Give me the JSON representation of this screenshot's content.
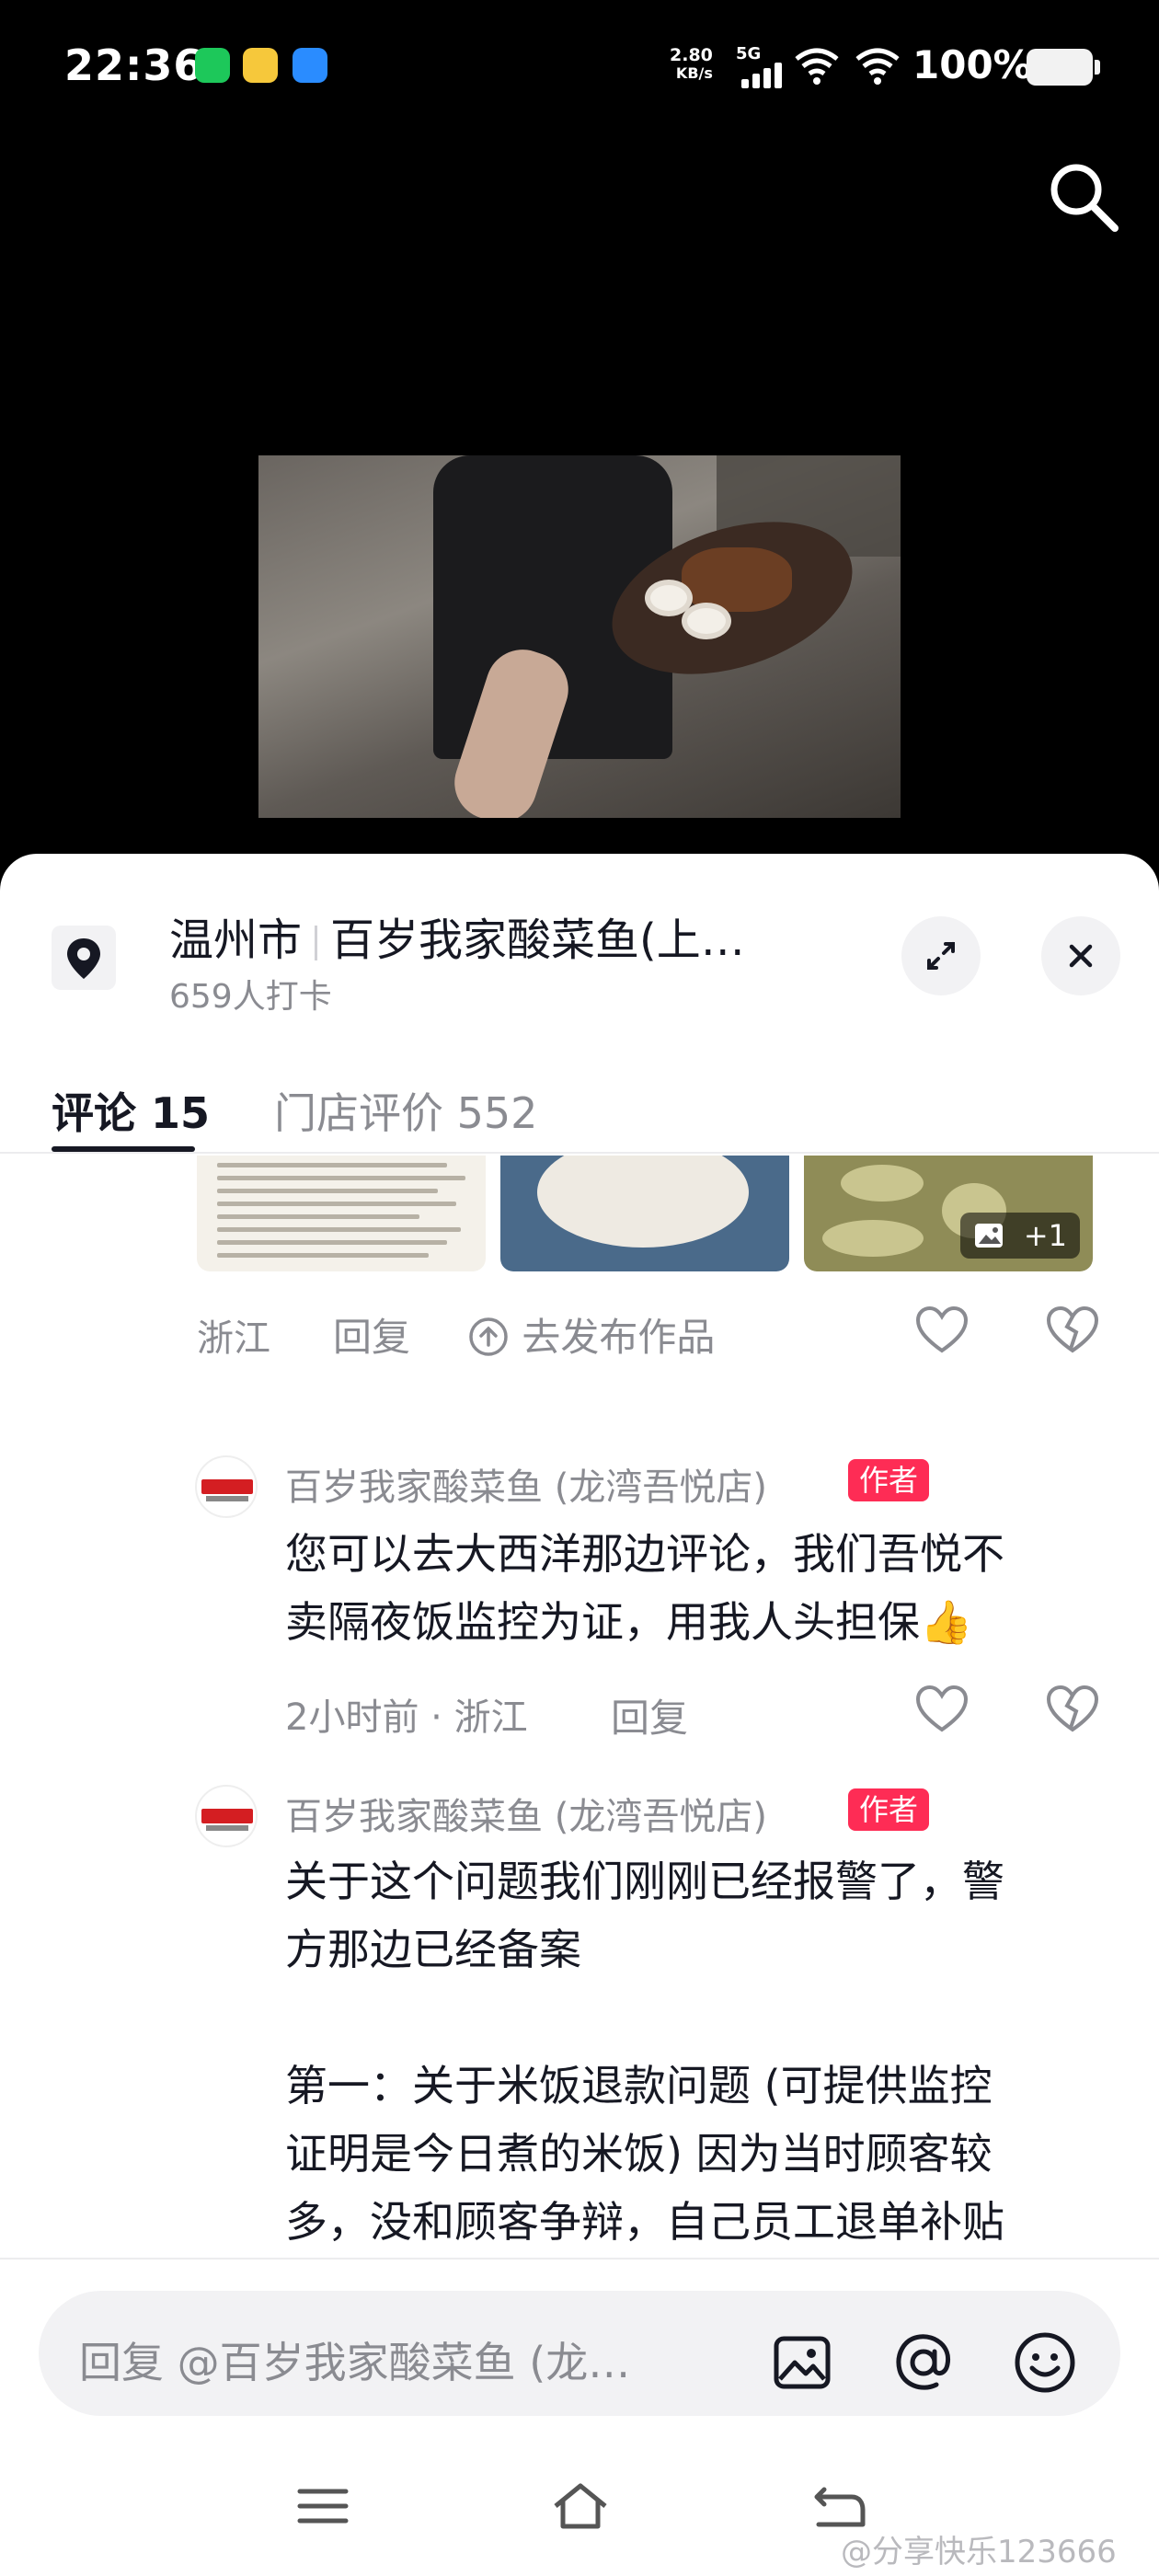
{
  "status_bar": {
    "time": "22:36",
    "net_speed": "2.80",
    "net_unit": "KB/s",
    "signal": "5G",
    "battery": "100%"
  },
  "location": {
    "city": "温州市",
    "store": "百岁我家酸菜鱼(上…",
    "checkins": "659人打卡"
  },
  "tabs": [
    {
      "label": "评论 15"
    },
    {
      "label": "门店评价 552"
    }
  ],
  "prev_comment": {
    "more_images": "+1",
    "region": "浙江",
    "reply": "回复",
    "publish": "去发布作品"
  },
  "replies": [
    {
      "author": "百岁我家酸菜鱼 (龙湾吾悦店)",
      "badge": "作者",
      "lines": [
        "您可以去大西洋那边评论，我们吾悦不",
        "卖隔夜饭监控为证，用我人头担保👍"
      ],
      "time": "2小时前 · 浙江",
      "reply": "回复"
    },
    {
      "author": "百岁我家酸菜鱼 (龙湾吾悦店)",
      "badge": "作者",
      "lines": [
        "关于这个问题我们刚刚已经报警了，警",
        "方那边已经备案",
        "",
        "第一：关于米饭退款问题 (可提供监控",
        "证明是今日煮的米饭) 因为当时顾客较",
        "多，没和顾客争辩，自己员工退单补贴"
      ]
    }
  ],
  "composer": {
    "placeholder": "回复 @百岁我家酸菜鱼 (龙…"
  },
  "watermark": "@分享快乐123666",
  "icons": [
    "search-icon",
    "location-pin-icon",
    "expand-icon",
    "close-icon",
    "share-icon",
    "heart-icon",
    "dislike-icon",
    "image-icon",
    "at-icon",
    "emoji-icon",
    "menu-icon",
    "home-icon",
    "back-icon"
  ],
  "colors": {
    "accent": "#fe2c55",
    "text": "#161823",
    "muted": "#8a8b91"
  }
}
